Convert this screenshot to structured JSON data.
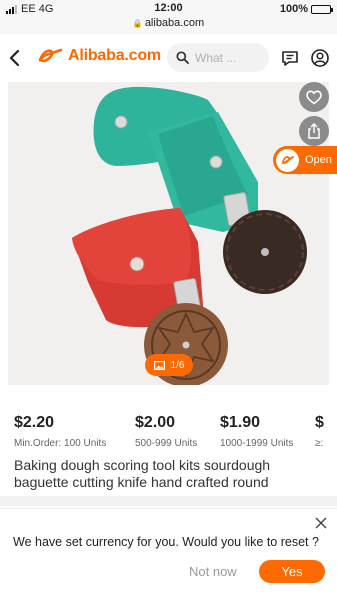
{
  "status_bar": {
    "carrier": "EE 4G",
    "time": "12:00",
    "url": "alibaba.com",
    "battery": "100%",
    "battery_level": 1.0
  },
  "header": {
    "brand": "Alibaba.com",
    "search_placeholder": "What ...",
    "accent_color": "#ff6a00"
  },
  "gallery": {
    "open_label": "Open",
    "counter": "1/6",
    "icons": [
      "heart-icon",
      "share-icon",
      "image-icon"
    ]
  },
  "prices": [
    {
      "amount": "$2.20",
      "quantity": "Min.Order: 100 Units"
    },
    {
      "amount": "$2.00",
      "quantity": "500-999 Units"
    },
    {
      "amount": "$1.90",
      "quantity": "1000-1999 Units"
    },
    {
      "amount": "$",
      "quantity": "≥:"
    }
  ],
  "product": {
    "title": "Baking dough scoring tool kits sourdough baguette cutting knife hand crafted round"
  },
  "currency_prompt": {
    "message": "We have set currency for you. Would you like to reset ?",
    "not_now": "Not now",
    "yes": "Yes"
  }
}
